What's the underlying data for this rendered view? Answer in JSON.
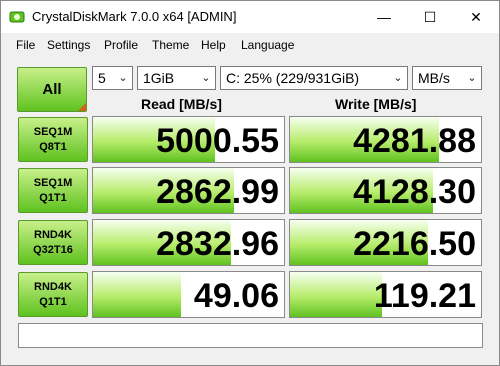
{
  "window": {
    "title": "CrystalDiskMark 7.0.0 x64 [ADMIN]",
    "minimize_glyph": "—",
    "maximize_glyph": "☐",
    "close_glyph": "✕"
  },
  "menu": [
    "File",
    "Settings",
    "Profile",
    "Theme",
    "Help",
    "Language"
  ],
  "controls": {
    "all_label": "All",
    "count": "5",
    "size": "1GiB",
    "drive": "C: 25% (229/931GiB)",
    "unit": "MB/s"
  },
  "headers": {
    "read": "Read [MB/s]",
    "write": "Write [MB/s]"
  },
  "tests": [
    {
      "line1": "SEQ1M",
      "line2": "Q8T1",
      "read": "5000.55",
      "write": "4281.88",
      "read_fill": 0.64,
      "write_fill": 0.78
    },
    {
      "line1": "SEQ1M",
      "line2": "Q1T1",
      "read": "2862.99",
      "write": "4128.30",
      "read_fill": 0.74,
      "write_fill": 0.75
    },
    {
      "line1": "RND4K",
      "line2": "Q32T16",
      "read": "2832.96",
      "write": "2216.50",
      "read_fill": 0.72,
      "write_fill": 0.72
    },
    {
      "line1": "RND4K",
      "line2": "Q1T1",
      "read": "49.06",
      "write": "119.21",
      "read_fill": 0.46,
      "write_fill": 0.48
    }
  ],
  "status": "",
  "colors": {
    "accent_green": "#5fc21f",
    "corner_orange": "#d0621a"
  }
}
